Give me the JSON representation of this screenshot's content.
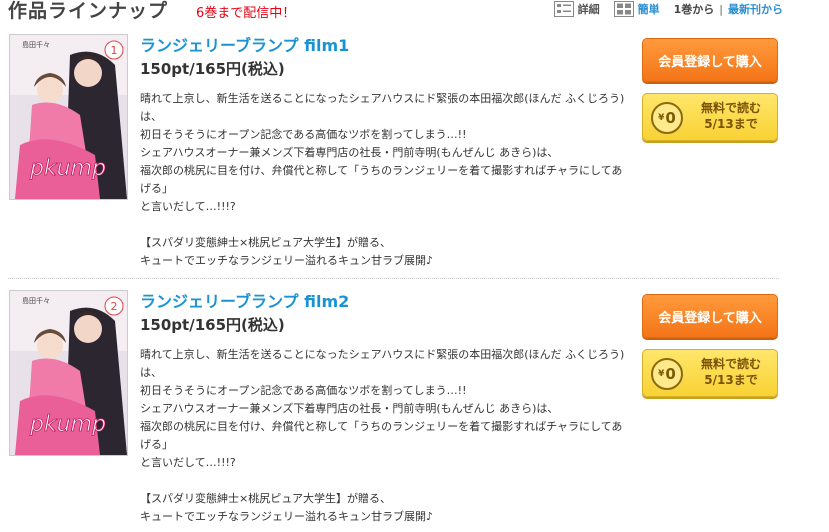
{
  "header": {
    "section_title": "作品ラインナップ",
    "notice": "6巻まで配信中！",
    "view_detail": "詳細",
    "view_simple": "簡単",
    "order_first": "1巻から",
    "order_separator": "|",
    "order_latest": "最新刊から"
  },
  "items": [
    {
      "cover_author": "島田千々",
      "cover_volume": "1",
      "title": "ランジェリーブランプ film1",
      "price": "150pt/165円(税込)",
      "desc": [
        "晴れて上京し、新生活を送ることになったシェアハウスにド緊張の本田福次郎(ほんだ ふくじろう)は、",
        "初日そうそうにオープン記念である高価なツボを割ってしまう…!!",
        "シェアハウスオーナー兼メンズ下着専門店の社長・門前寺明(もんぜんじ あきら)は、",
        "福次郎の桃尻に目を付け、弁償代と称して「うちのランジェリーを着て撮影すればチャラにしてあげる」",
        "と言いだして…!!!?",
        "",
        "【スパダリ変態紳士×桃尻ピュア大学生】が贈る、",
        "キュートでエッチなランジェリー溢れるキュン甘ラブ展開♪"
      ],
      "buy_label": "会員登録して購入",
      "free_line1": "無料で読む",
      "free_line2": "5/13まで",
      "yen_value": "0",
      "yen_symbol": "¥"
    },
    {
      "cover_author": "島田千々",
      "cover_volume": "2",
      "title": "ランジェリーブランプ film2",
      "price": "150pt/165円(税込)",
      "desc": [
        "晴れて上京し、新生活を送ることになったシェアハウスにド緊張の本田福次郎(ほんだ ふくじろう)は、",
        "初日そうそうにオープン記念である高価なツボを割ってしまう…!!",
        "シェアハウスオーナー兼メンズ下着専門店の社長・門前寺明(もんぜんじ あきら)は、",
        "福次郎の桃尻に目を付け、弁償代と称して「うちのランジェリーを着て撮影すればチャラにしてあげる」",
        "と言いだして…!!!?",
        "",
        "【スパダリ変態紳士×桃尻ピュア大学生】が贈る、",
        "キュートでエッチなランジェリー溢れるキュン甘ラブ展開♪"
      ],
      "buy_label": "会員登録して購入",
      "free_line1": "無料で読む",
      "free_line2": "5/13まで",
      "yen_value": "0",
      "yen_symbol": "¥"
    }
  ],
  "colors": {
    "title_blue": "#1a93d3",
    "notice_red": "#e60012",
    "buy_orange": "#f47518",
    "free_yellow": "#f8d234"
  }
}
